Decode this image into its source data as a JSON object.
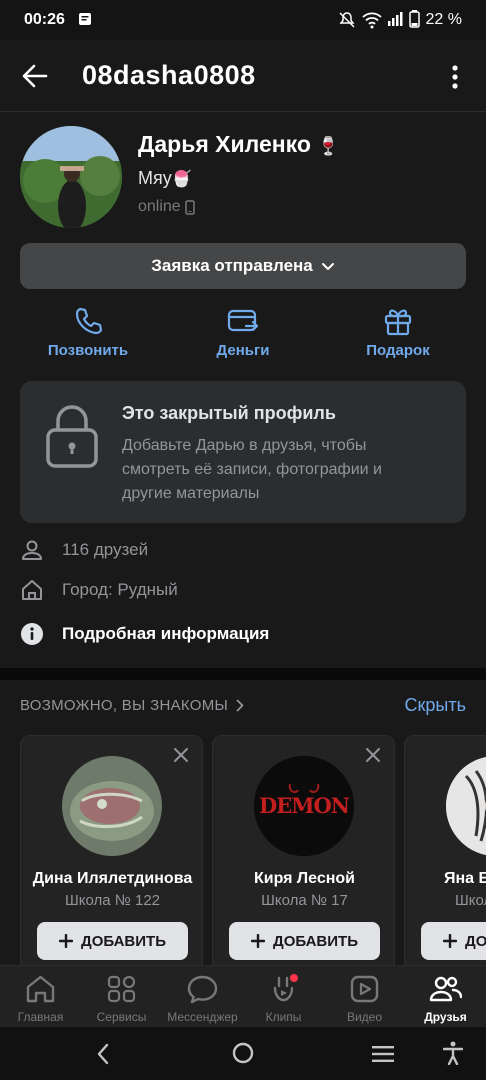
{
  "status_bar": {
    "time": "00:26",
    "battery": "22 %"
  },
  "header": {
    "title": "08dasha0808"
  },
  "profile": {
    "name": "Дарья Хиленко",
    "name_emoji": "🍷",
    "status": "Мяу",
    "status_emoji": "🍧",
    "online": "online"
  },
  "request_button": {
    "label": "Заявка отправлена"
  },
  "actions": [
    {
      "label": "Позвонить",
      "icon": "phone-icon"
    },
    {
      "label": "Деньги",
      "icon": "money-card-icon"
    },
    {
      "label": "Подарок",
      "icon": "gift-icon"
    }
  ],
  "closed_profile": {
    "title": "Это закрытый профиль",
    "description": "Добавьте Дарью в друзья, чтобы смотреть её записи, фотографии и другие материалы"
  },
  "info": {
    "friends": "116 друзей",
    "city": "Город: Рудный",
    "details": "Подробная информация"
  },
  "suggestions": {
    "heading": "ВОЗМОЖНО, ВЫ ЗНАКОМЫ",
    "hide": "Скрыть",
    "add_label": "ДОБАВИТЬ",
    "cards": [
      {
        "name": "Дина Илялетдинова",
        "school": "Школа № 122"
      },
      {
        "name": "Киря Лесной",
        "school": "Школа № 17",
        "avatar_text": "DEMON"
      },
      {
        "name": "Яна Е",
        "school": "Школ"
      }
    ]
  },
  "tabbar": {
    "tabs": [
      {
        "label": "Главная",
        "icon": "home-icon"
      },
      {
        "label": "Сервисы",
        "icon": "services-icon"
      },
      {
        "label": "Мессенджер",
        "icon": "messenger-icon"
      },
      {
        "label": "Клипы",
        "icon": "clips-icon"
      },
      {
        "label": "Видео",
        "icon": "video-icon"
      },
      {
        "label": "Друзья",
        "icon": "friends-icon",
        "active": true
      }
    ]
  },
  "colors": {
    "background": "#19191a",
    "accent": "#71aaeb",
    "card": "#2c2d2e",
    "notification_dot": "#ff3347"
  }
}
